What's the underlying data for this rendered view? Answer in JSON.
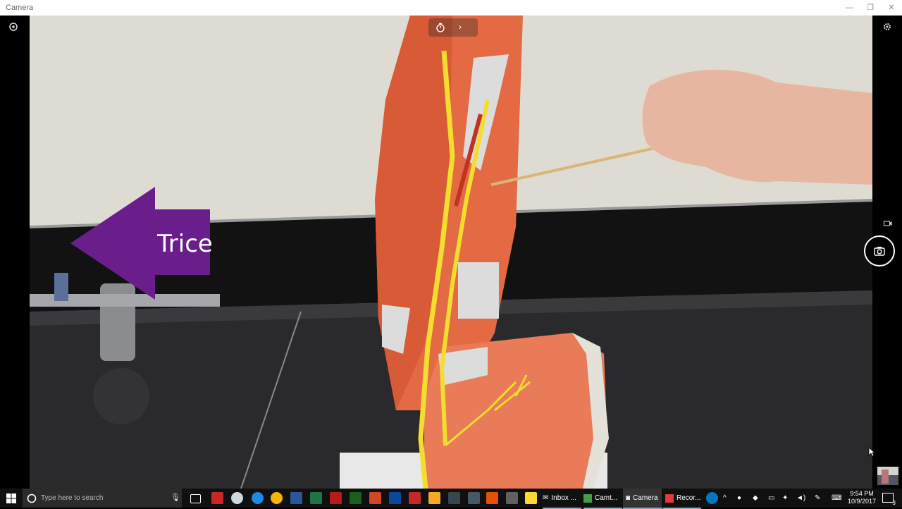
{
  "window": {
    "title": "Camera"
  },
  "overlay": {
    "label": "Trice"
  },
  "taskbar": {
    "search_placeholder": "Type here to search",
    "apps": [
      {
        "label": "Inbox ..."
      },
      {
        "label": "Camt..."
      },
      {
        "label": "Camera"
      },
      {
        "label": "Recor..."
      }
    ],
    "time": "9:54 PM",
    "date": "10/9/2017",
    "notification_count": "3"
  },
  "colors": {
    "arrow": "#6a1e8c",
    "muscle": "#e36a43",
    "nerve": "#f3dd2e",
    "tendon": "#dcdcdc"
  }
}
